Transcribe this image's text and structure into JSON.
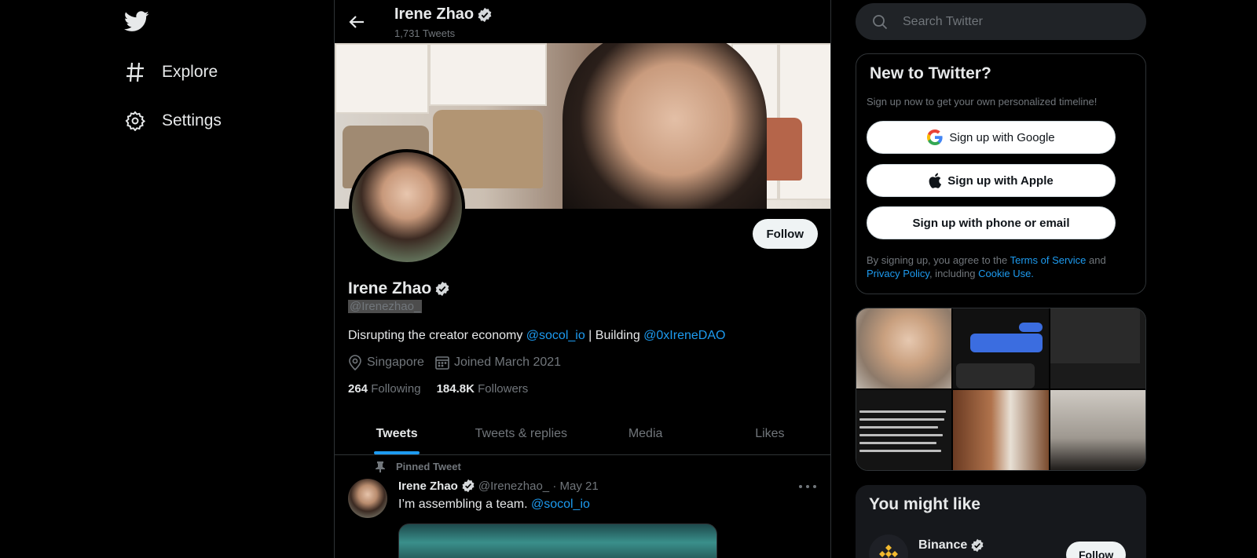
{
  "nav": {
    "logo": "twitter-bird-icon",
    "items": [
      {
        "label": "Explore",
        "icon": "hashtag-icon"
      },
      {
        "label": "Settings",
        "icon": "gear-icon"
      }
    ]
  },
  "header": {
    "name": "Irene Zhao",
    "tweet_count": "1,731 Tweets"
  },
  "profile": {
    "name": "Irene Zhao",
    "handle": "@Irenezhao_",
    "follow_label": "Follow",
    "bio_prefix": "Disrupting the creator economy ",
    "bio_link1": "@socol_io",
    "bio_mid": " | Building ",
    "bio_link2": "@0xIreneDAO",
    "location": "Singapore",
    "joined": "Joined March 2021",
    "following_count": "264",
    "following_label": "Following",
    "followers_count": "184.8K",
    "followers_label": "Followers"
  },
  "tabs": [
    "Tweets",
    "Tweets & replies",
    "Media",
    "Likes"
  ],
  "tweet": {
    "pinned_label": "Pinned Tweet",
    "name": "Irene Zhao",
    "handle": "@Irenezhao_",
    "sep": "·",
    "date": "May 21",
    "text_prefix": "I’m assembling a team. ",
    "text_link": "@socol_io"
  },
  "search": {
    "placeholder": "Search Twitter"
  },
  "signup": {
    "title": "New to Twitter?",
    "subtitle": "Sign up now to get your own personalized timeline!",
    "google": "Sign up with Google",
    "apple": "Sign up with Apple",
    "phone": "Sign up with phone or email",
    "terms_prefix": "By signing up, you agree to the ",
    "terms_link": "Terms of Service",
    "terms_and": " and",
    "privacy_link": "Privacy Policy",
    "terms_including": ", including ",
    "cookie_link": "Cookie Use."
  },
  "suggest": {
    "title": "You might like",
    "name": "Binance",
    "follow_label": "Follow"
  },
  "colors": {
    "accent": "#1d9bf0",
    "background": "#000000",
    "muted": "#71767b"
  }
}
